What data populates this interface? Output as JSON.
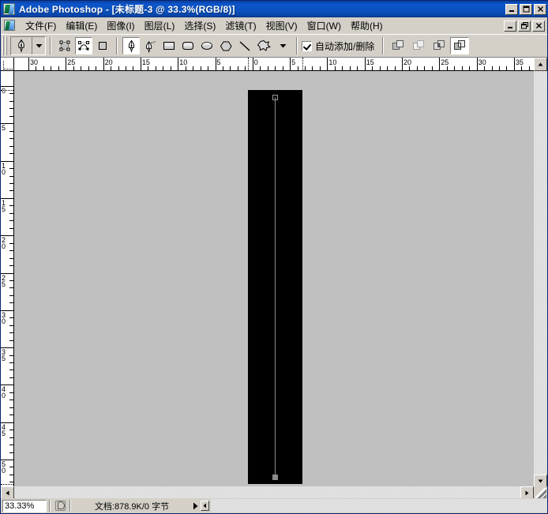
{
  "window": {
    "title": "Adobe Photoshop - [未标题-3 @ 33.3%(RGB/8)]",
    "app_icon": "photoshop-logo-icon",
    "minimize_label": "_",
    "maximize_label": "□",
    "close_label": "✕"
  },
  "menubar": {
    "doc_icon": "photoshop-document-icon",
    "items": [
      {
        "label": "文件(F)"
      },
      {
        "label": "编辑(E)"
      },
      {
        "label": "图像(I)"
      },
      {
        "label": "图层(L)"
      },
      {
        "label": "选择(S)"
      },
      {
        "label": "滤镜(T)"
      },
      {
        "label": "视图(V)"
      },
      {
        "label": "窗口(W)"
      },
      {
        "label": "帮助(H)"
      }
    ],
    "doc_minimize_label": "_",
    "doc_restore_label": "❐",
    "doc_close_label": "✕"
  },
  "options_bar": {
    "tool_preview_icon": "pen-tool-icon",
    "tool_preset_arrow": "chevron-down-icon",
    "modes": [
      {
        "name": "shape-layers-mode",
        "icon": "shape-layer-icon",
        "selected": false
      },
      {
        "name": "paths-mode",
        "icon": "paths-icon",
        "selected": true
      },
      {
        "name": "fill-pixels-mode",
        "icon": "fill-pixels-icon",
        "selected": false
      }
    ],
    "shape_tools": [
      {
        "name": "pen-tool",
        "icon": "pen-icon",
        "selected": true
      },
      {
        "name": "freeform-pen-tool",
        "icon": "freeform-pen-icon",
        "selected": false
      },
      {
        "name": "rectangle-tool",
        "icon": "rectangle-icon",
        "selected": false
      },
      {
        "name": "rounded-rectangle-tool",
        "icon": "rounded-rectangle-icon",
        "selected": false
      },
      {
        "name": "ellipse-tool",
        "icon": "ellipse-icon",
        "selected": false
      },
      {
        "name": "polygon-tool",
        "icon": "polygon-icon",
        "selected": false
      },
      {
        "name": "line-tool",
        "icon": "line-icon",
        "selected": false
      },
      {
        "name": "custom-shape-tool",
        "icon": "custom-shape-icon",
        "selected": false
      }
    ],
    "geometry_options_arrow": "chevron-down-icon",
    "auto_add_delete": {
      "label": "自动添加/删除",
      "checked": true
    },
    "path_ops": [
      {
        "name": "add-to-path-area",
        "icon": "add-shape-icon",
        "selected": false
      },
      {
        "name": "subtract-from-path-area",
        "icon": "subtract-shape-icon",
        "selected": false
      },
      {
        "name": "intersect-path-areas",
        "icon": "intersect-shape-icon",
        "selected": false
      },
      {
        "name": "exclude-overlapping-path-areas",
        "icon": "exclude-shape-icon",
        "selected": true
      }
    ]
  },
  "rulers": {
    "unit": "cm",
    "horizontal_labels": [
      "30",
      "25",
      "20",
      "15",
      "10",
      "5",
      "0",
      "5",
      "10",
      "15",
      "20",
      "25",
      "30",
      "35"
    ],
    "vertical_labels": [
      "0",
      "5",
      "10",
      "15",
      "20",
      "25",
      "30",
      "35",
      "40",
      "45",
      "50"
    ]
  },
  "canvas": {
    "background_color": "#c0c0c0",
    "image_color": "#000000",
    "path_color": "#8c8c8c",
    "anchors": [
      {
        "name": "path-anchor-top",
        "filled": false
      },
      {
        "name": "path-anchor-bottom",
        "filled": true
      }
    ]
  },
  "scrollbars": {
    "v_up_icon": "triangle-up-icon",
    "v_down_icon": "triangle-down-icon",
    "h_left_icon": "triangle-left-icon",
    "h_right_icon": "triangle-right-icon",
    "resize_grip": "resize-grip-icon"
  },
  "statusbar": {
    "zoom_value": "33.33%",
    "preview_icon": "proxy-preview-icon",
    "doc_info": "文档:878.9K/0 字节",
    "popup_arrow": "triangle-right-icon",
    "status_arrow": "triangle-left-icon"
  }
}
